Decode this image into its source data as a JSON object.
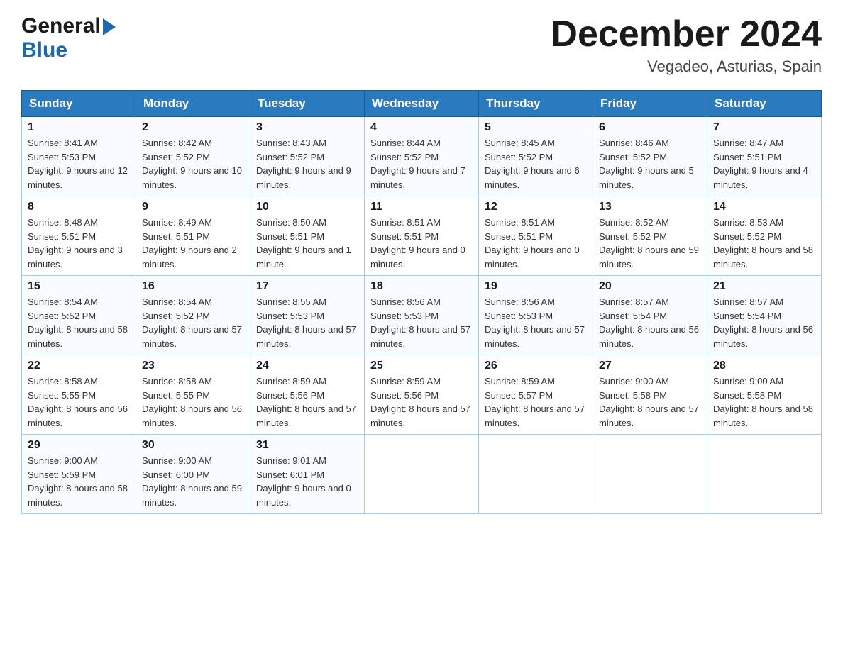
{
  "header": {
    "logo": {
      "general": "General",
      "blue": "Blue"
    },
    "title": "December 2024",
    "location": "Vegadeo, Asturias, Spain"
  },
  "weekdays": [
    "Sunday",
    "Monday",
    "Tuesday",
    "Wednesday",
    "Thursday",
    "Friday",
    "Saturday"
  ],
  "weeks": [
    [
      {
        "day": "1",
        "sunrise": "8:41 AM",
        "sunset": "5:53 PM",
        "daylight": "9 hours and 12 minutes."
      },
      {
        "day": "2",
        "sunrise": "8:42 AM",
        "sunset": "5:52 PM",
        "daylight": "9 hours and 10 minutes."
      },
      {
        "day": "3",
        "sunrise": "8:43 AM",
        "sunset": "5:52 PM",
        "daylight": "9 hours and 9 minutes."
      },
      {
        "day": "4",
        "sunrise": "8:44 AM",
        "sunset": "5:52 PM",
        "daylight": "9 hours and 7 minutes."
      },
      {
        "day": "5",
        "sunrise": "8:45 AM",
        "sunset": "5:52 PM",
        "daylight": "9 hours and 6 minutes."
      },
      {
        "day": "6",
        "sunrise": "8:46 AM",
        "sunset": "5:52 PM",
        "daylight": "9 hours and 5 minutes."
      },
      {
        "day": "7",
        "sunrise": "8:47 AM",
        "sunset": "5:51 PM",
        "daylight": "9 hours and 4 minutes."
      }
    ],
    [
      {
        "day": "8",
        "sunrise": "8:48 AM",
        "sunset": "5:51 PM",
        "daylight": "9 hours and 3 minutes."
      },
      {
        "day": "9",
        "sunrise": "8:49 AM",
        "sunset": "5:51 PM",
        "daylight": "9 hours and 2 minutes."
      },
      {
        "day": "10",
        "sunrise": "8:50 AM",
        "sunset": "5:51 PM",
        "daylight": "9 hours and 1 minute."
      },
      {
        "day": "11",
        "sunrise": "8:51 AM",
        "sunset": "5:51 PM",
        "daylight": "9 hours and 0 minutes."
      },
      {
        "day": "12",
        "sunrise": "8:51 AM",
        "sunset": "5:51 PM",
        "daylight": "9 hours and 0 minutes."
      },
      {
        "day": "13",
        "sunrise": "8:52 AM",
        "sunset": "5:52 PM",
        "daylight": "8 hours and 59 minutes."
      },
      {
        "day": "14",
        "sunrise": "8:53 AM",
        "sunset": "5:52 PM",
        "daylight": "8 hours and 58 minutes."
      }
    ],
    [
      {
        "day": "15",
        "sunrise": "8:54 AM",
        "sunset": "5:52 PM",
        "daylight": "8 hours and 58 minutes."
      },
      {
        "day": "16",
        "sunrise": "8:54 AM",
        "sunset": "5:52 PM",
        "daylight": "8 hours and 57 minutes."
      },
      {
        "day": "17",
        "sunrise": "8:55 AM",
        "sunset": "5:53 PM",
        "daylight": "8 hours and 57 minutes."
      },
      {
        "day": "18",
        "sunrise": "8:56 AM",
        "sunset": "5:53 PM",
        "daylight": "8 hours and 57 minutes."
      },
      {
        "day": "19",
        "sunrise": "8:56 AM",
        "sunset": "5:53 PM",
        "daylight": "8 hours and 57 minutes."
      },
      {
        "day": "20",
        "sunrise": "8:57 AM",
        "sunset": "5:54 PM",
        "daylight": "8 hours and 56 minutes."
      },
      {
        "day": "21",
        "sunrise": "8:57 AM",
        "sunset": "5:54 PM",
        "daylight": "8 hours and 56 minutes."
      }
    ],
    [
      {
        "day": "22",
        "sunrise": "8:58 AM",
        "sunset": "5:55 PM",
        "daylight": "8 hours and 56 minutes."
      },
      {
        "day": "23",
        "sunrise": "8:58 AM",
        "sunset": "5:55 PM",
        "daylight": "8 hours and 56 minutes."
      },
      {
        "day": "24",
        "sunrise": "8:59 AM",
        "sunset": "5:56 PM",
        "daylight": "8 hours and 57 minutes."
      },
      {
        "day": "25",
        "sunrise": "8:59 AM",
        "sunset": "5:56 PM",
        "daylight": "8 hours and 57 minutes."
      },
      {
        "day": "26",
        "sunrise": "8:59 AM",
        "sunset": "5:57 PM",
        "daylight": "8 hours and 57 minutes."
      },
      {
        "day": "27",
        "sunrise": "9:00 AM",
        "sunset": "5:58 PM",
        "daylight": "8 hours and 57 minutes."
      },
      {
        "day": "28",
        "sunrise": "9:00 AM",
        "sunset": "5:58 PM",
        "daylight": "8 hours and 58 minutes."
      }
    ],
    [
      {
        "day": "29",
        "sunrise": "9:00 AM",
        "sunset": "5:59 PM",
        "daylight": "8 hours and 58 minutes."
      },
      {
        "day": "30",
        "sunrise": "9:00 AM",
        "sunset": "6:00 PM",
        "daylight": "8 hours and 59 minutes."
      },
      {
        "day": "31",
        "sunrise": "9:01 AM",
        "sunset": "6:01 PM",
        "daylight": "9 hours and 0 minutes."
      },
      null,
      null,
      null,
      null
    ]
  ]
}
